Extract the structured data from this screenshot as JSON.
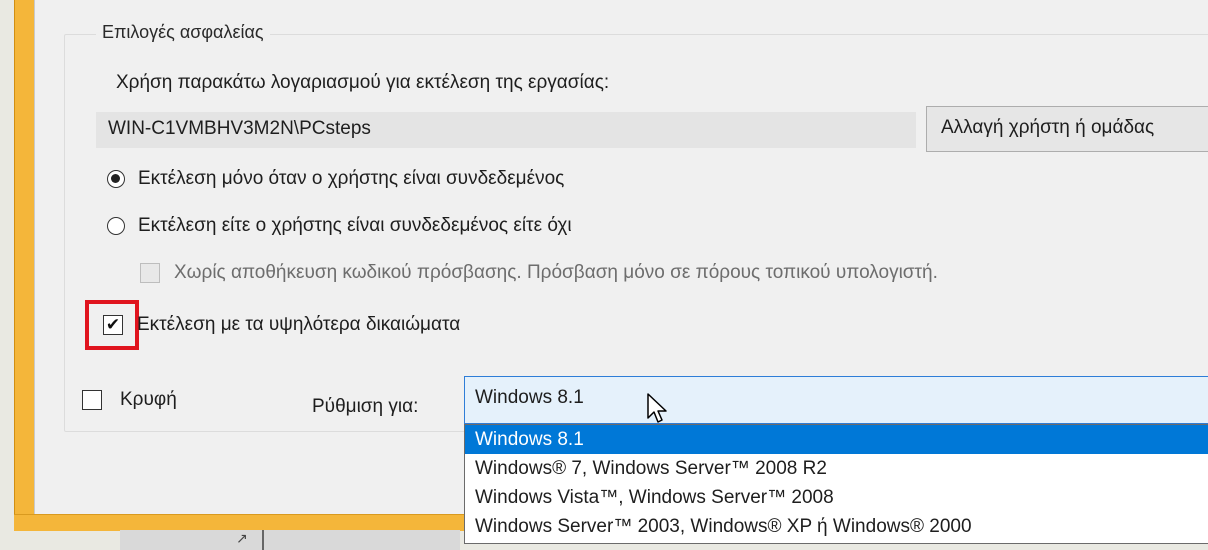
{
  "security_options": {
    "group_title": "Επιλογές ασφαλείας",
    "account_prompt": "Χρήση παρακάτω λογαριασμού για εκτέλεση της εργασίας:",
    "account_value": "WIN-C1VMBHV3M2N\\PCsteps",
    "change_user_button": "Αλλαγή χρήστη ή ομάδας",
    "radio_logged_on": "Εκτέλεση μόνο όταν ο χρήστης είναι συνδεδεμένος",
    "radio_logged_on_selected": true,
    "radio_whether": "Εκτέλεση είτε ο χρήστης είναι συνδεδεμένος είτε όχι",
    "no_store_password": "Χωρίς αποθήκευση κωδικού πρόσβασης. Πρόσβαση μόνο σε πόρους τοπικού υπολογιστή.",
    "highest_privileges": "Εκτέλεση με τα υψηλότερα δικαιώματα",
    "highest_privileges_checked": true,
    "hidden_label": "Κρυφή",
    "hidden_checked": false,
    "configure_for_label": "Ρύθμιση για:",
    "configure_for_value": "Windows 8.1",
    "configure_options": [
      "Windows 8.1",
      "Windows® 7, Windows Server™ 2008 R2",
      "Windows Vista™, Windows Server™ 2008",
      "Windows Server™ 2003, Windows® XP ή Windows® 2000"
    ]
  },
  "colors": {
    "window_frame": "#f4b63a",
    "highlight": "#e0141e",
    "selection": "#0078d7"
  }
}
